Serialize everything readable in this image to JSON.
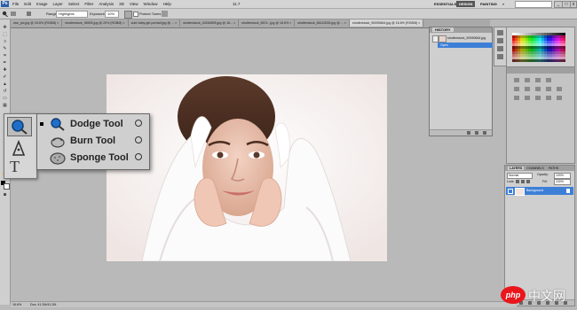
{
  "menubar": {
    "app_logo": "Ps",
    "menus": [
      "File",
      "Edit",
      "Image",
      "Layer",
      "Select",
      "Filter",
      "Analysis",
      "3D",
      "View",
      "Window",
      "Help"
    ],
    "zoom": "11.7",
    "workspaces": {
      "essentials": "ESSENTIALS",
      "design": "DESIGN",
      "painting": "PAINTING",
      "more": "»"
    },
    "window_buttons": [
      "_",
      "□",
      "x"
    ]
  },
  "options_bar": {
    "range_label": "Range:",
    "range_value": "Highlights",
    "exposure_label": "Exposure:",
    "exposure_value": "10%",
    "protect_tones": "Protect Tones"
  },
  "tabs": [
    {
      "label": "use_pic.jpg @ 16.6% (RGB/8) ×",
      "active": false
    },
    {
      "label": "shutterstock_98905.jpg @ 20% (RGB/8) ×",
      "active": false
    },
    {
      "label": "cute-baby-girl-portrait.jpg @ ... ×",
      "active": false
    },
    {
      "label": "shutterstock_43260895.jpg @ 16... ×",
      "active": false
    },
    {
      "label": "shutterstock_5874...jpg @ 16.6% ×",
      "active": false
    },
    {
      "label": "shutterstock_66110028.jpg @ ... ×",
      "active": false
    },
    {
      "label": "shutterstock_90090664.jpg @ 16.6% (RGB/8) ×",
      "active": true
    }
  ],
  "history_panel": {
    "tab": "HISTORY",
    "snapshot": "shutterstock_90090664.jpg",
    "item": "Open"
  },
  "layers_panel": {
    "tabs": [
      "LAYERS",
      "CHANNELS",
      "PATHS"
    ],
    "blend_mode": "Normal",
    "opacity_label": "Opacity:",
    "opacity_value": "100%",
    "lock_label": "Lock:",
    "fill_label": "Fill:",
    "fill_value": "100%",
    "layer_name": "Background"
  },
  "flyout": {
    "items": [
      {
        "label": "Dodge Tool",
        "key": "O",
        "selected": true,
        "icon": "dodge-icon"
      },
      {
        "label": "Burn Tool",
        "key": "O",
        "selected": false,
        "icon": "burn-icon"
      },
      {
        "label": "Sponge Tool",
        "key": "O",
        "selected": false,
        "icon": "sponge-icon"
      }
    ]
  },
  "status_bar": {
    "zoom": "16.6%",
    "doc": "Doc: 41.2M/41.2M"
  },
  "watermark": {
    "brand": "php",
    "text": "中文网"
  },
  "colors": {
    "selection_blue": "#3d7fd6",
    "panel_gray": "#cfcfcf",
    "workspace_gray": "#b9b9b9"
  }
}
